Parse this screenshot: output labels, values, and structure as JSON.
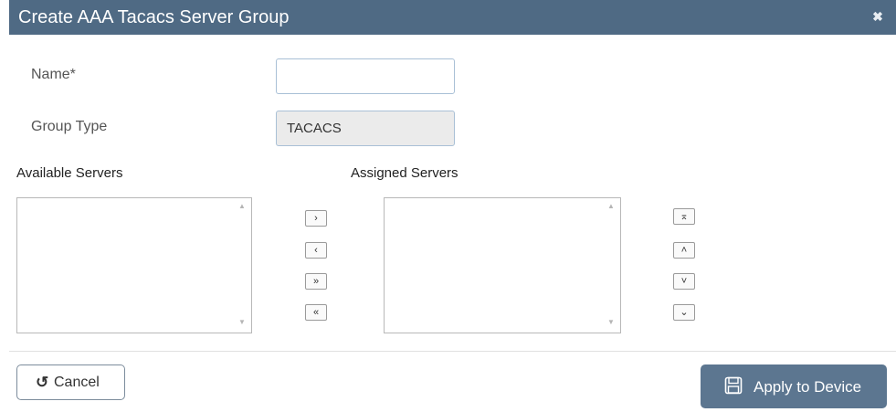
{
  "dialog": {
    "title": "Create AAA Tacacs Server Group",
    "close_icon": "close-icon"
  },
  "form": {
    "name_label": "Name*",
    "name_value": "",
    "name_placeholder": "",
    "group_type_label": "Group Type",
    "group_type_value": "TACACS"
  },
  "servers": {
    "available_label": "Available Servers",
    "assigned_label": "Assigned Servers",
    "available_items": [],
    "assigned_items": []
  },
  "transfer_buttons": {
    "move_right": "›",
    "move_left": "‹",
    "move_all_right": "»",
    "move_all_left": "«"
  },
  "order_buttons": {
    "move_top": "⌅",
    "move_up": "˄",
    "move_down": "˅",
    "move_bottom": "⌄"
  },
  "footer": {
    "cancel_label": "Cancel",
    "cancel_icon": "undo-icon",
    "apply_label": "Apply to Device",
    "apply_icon": "save-icon"
  },
  "colors": {
    "titlebar": "#4f6a84",
    "apply_button": "#5c7690",
    "field_border": "#a9c0d6"
  }
}
